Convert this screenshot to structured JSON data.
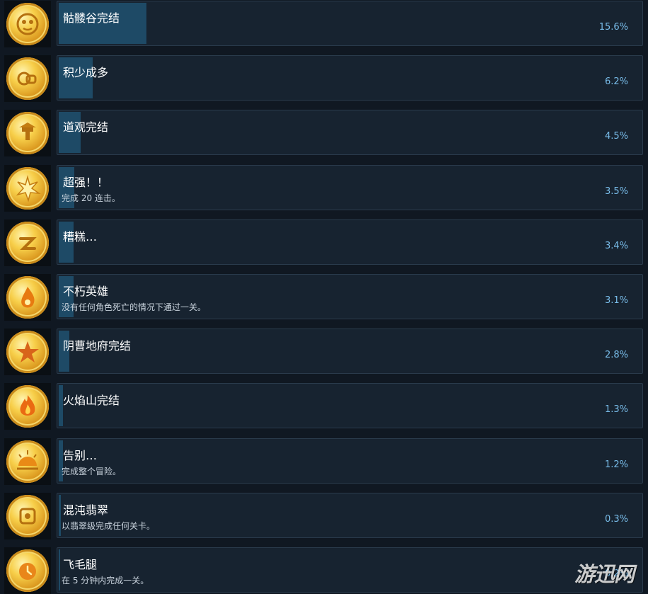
{
  "achievements": [
    {
      "icon": "skull-mask-icon",
      "name": "骷髅谷完结",
      "description": "",
      "percent_label": "15.6%",
      "percent": 15.6
    },
    {
      "icon": "coins-icon",
      "name": "积少成多",
      "description": "",
      "percent_label": "6.2%",
      "percent": 6.2
    },
    {
      "icon": "temple-icon",
      "name": "道观完结",
      "description": "",
      "percent_label": "4.5%",
      "percent": 4.5
    },
    {
      "icon": "burst-icon",
      "name": "超强！！",
      "description": "完成 20 连击。",
      "percent_label": "3.5%",
      "percent": 3.5
    },
    {
      "icon": "swirl-icon",
      "name": "糟糕…",
      "description": "",
      "percent_label": "3.4%",
      "percent": 3.4
    },
    {
      "icon": "flame-drop-icon",
      "name": "不朽英雄",
      "description": "没有任何角色死亡的情况下通过一关。",
      "percent_label": "3.1%",
      "percent": 3.1
    },
    {
      "icon": "star-icon",
      "name": "阴曹地府完结",
      "description": "",
      "percent_label": "2.8%",
      "percent": 2.8
    },
    {
      "icon": "fire-icon",
      "name": "火焰山完结",
      "description": "",
      "percent_label": "1.3%",
      "percent": 1.3
    },
    {
      "icon": "sunset-icon",
      "name": "告别…",
      "description": "完成整个冒险。",
      "percent_label": "1.2%",
      "percent": 1.2
    },
    {
      "icon": "emblem-icon",
      "name": "混沌翡翠",
      "description": "以翡翠级完成任何关卡。",
      "percent_label": "0.3%",
      "percent": 0.3
    },
    {
      "icon": "clock-icon",
      "name": "飞毛腿",
      "description": "在 5 分钟内完成一关。",
      "percent_label": "0.2%",
      "percent": 0.2
    }
  ],
  "watermark": "游迅网",
  "colors": {
    "background": "#101822",
    "panel": "#172330",
    "panel_border": "#2a3b4c",
    "progress_fill": "#1e4a66",
    "percent_text": "#79bdea",
    "coin_gold": "#f7cf4a"
  }
}
